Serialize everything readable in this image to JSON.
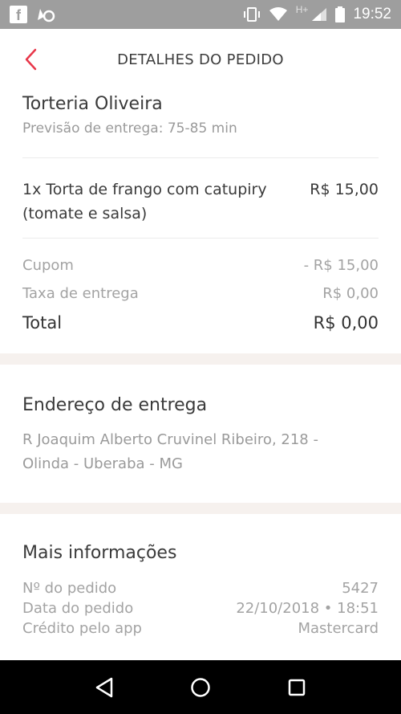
{
  "status_bar": {
    "time": "19:52",
    "network": "H+"
  },
  "header": {
    "title": "DETALHES DO PEDIDO"
  },
  "order": {
    "store_name": "Torteria Oliveira",
    "delivery_estimate": "Previsão de entrega: 75-85 min",
    "item": {
      "name": "1x Torta de frango com catupiry (tomate e salsa)",
      "price": "R$ 15,00"
    },
    "coupon_label": "Cupom",
    "coupon_value": "- R$ 15,00",
    "delivery_fee_label": "Taxa de entrega",
    "delivery_fee_value": "R$ 0,00",
    "total_label": "Total",
    "total_value": "R$ 0,00"
  },
  "address": {
    "title": "Endereço de entrega",
    "line1": "R Joaquim Alberto Cruvinel Ribeiro, 218 -",
    "line2": "Olinda - Uberaba - MG"
  },
  "more_info": {
    "title": "Mais informações",
    "rows": [
      {
        "label": "Nº do pedido",
        "value": "5427"
      },
      {
        "label": "Data do pedido",
        "value": "22/10/2018 • 18:51"
      },
      {
        "label": "Crédito pelo app",
        "value": "Mastercard"
      }
    ]
  },
  "colors": {
    "accent": "#e8374a",
    "band": "#f6f1ee",
    "status_bar": "#9e9e9e"
  },
  "icons": {
    "back": "chevron-left-icon",
    "nav_back": "triangle-back-icon",
    "nav_home": "circle-home-icon",
    "nav_recents": "square-recents-icon"
  }
}
